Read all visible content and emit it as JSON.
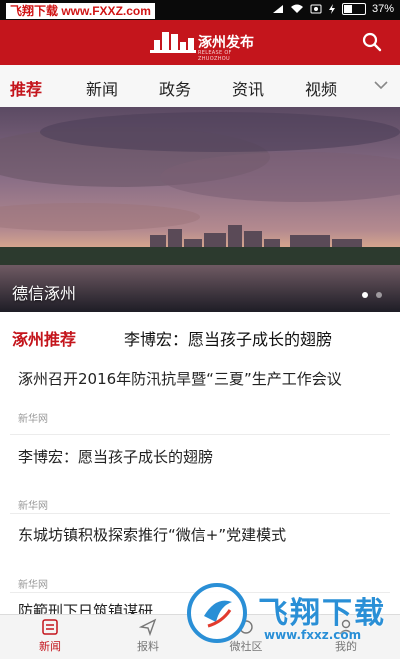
{
  "status_bar": {
    "watermark": "飞翔下载 www.FXXZ.com",
    "battery": "37%"
  },
  "header": {
    "logo_title": "涿州发布",
    "logo_sub": "RELEASE OF ZHUOZHOU"
  },
  "tabs": [
    {
      "label": "推荐",
      "active": true
    },
    {
      "label": "新闻"
    },
    {
      "label": "政务"
    },
    {
      "label": "资讯"
    },
    {
      "label": "视频"
    }
  ],
  "banner": {
    "caption": "德信涿州",
    "slides": 2,
    "current": 1
  },
  "recommend": {
    "label": "涿州推荐",
    "headline": "李博宏：愿当孩子成长的翅膀"
  },
  "news": [
    {
      "title": "涿州召开2016年防汛抗旱暨“三夏”生产工作会议",
      "source": "新华网"
    },
    {
      "title": "李博宏：愿当孩子成长的翅膀",
      "source": "新华网"
    },
    {
      "title": "东城坊镇积极探索推行“微信+”党建模式",
      "source": "新华网"
    },
    {
      "title": "防範刑下日筑镇谋研",
      "source": ""
    }
  ],
  "bottom_nav": [
    {
      "label": "新闻",
      "icon": "news-icon",
      "active": true
    },
    {
      "label": "报料",
      "icon": "send-icon"
    },
    {
      "label": "微社区",
      "icon": "community-icon"
    },
    {
      "label": "我的",
      "icon": "profile-icon"
    }
  ],
  "watermark_bottom": {
    "text": "飞翔下载",
    "url": "www.fxxz.com"
  },
  "colors": {
    "brand": "#c4151c",
    "watermark_blue": "#2a8fd6"
  }
}
